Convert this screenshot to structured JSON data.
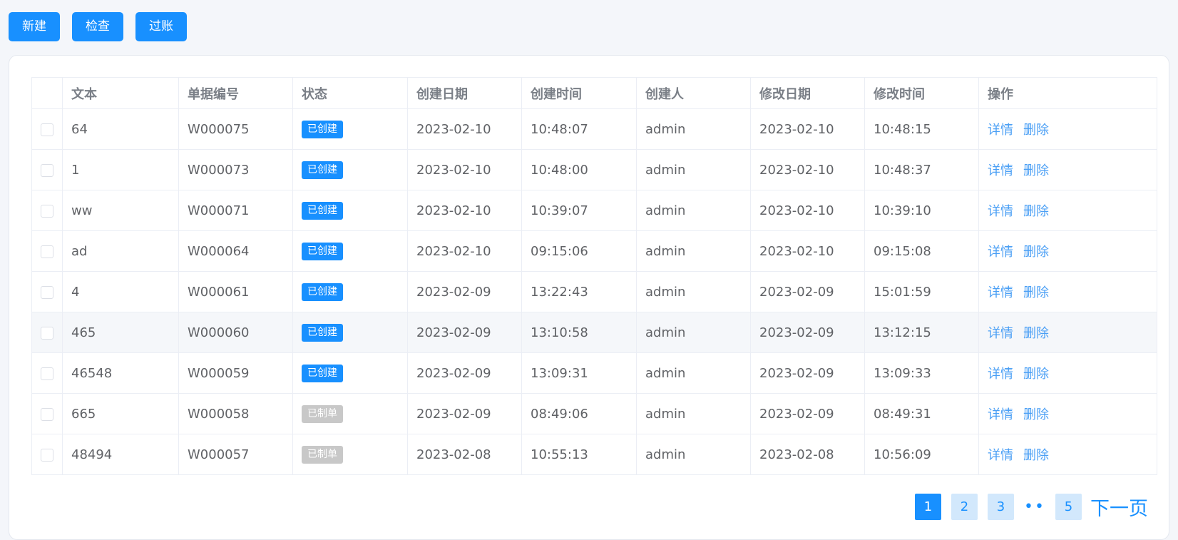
{
  "toolbar": {
    "new_label": "新建",
    "check_label": "检查",
    "post_label": "过账"
  },
  "table": {
    "headers": [
      "文本",
      "单据编号",
      "状态",
      "创建日期",
      "创建时间",
      "创建人",
      "修改日期",
      "修改时间",
      "操作"
    ],
    "actions": {
      "detail": "详情",
      "delete": "删除"
    },
    "rows": [
      {
        "text": "64",
        "code": "W000075",
        "status": "已创建",
        "cdate": "2023-02-10",
        "ctime": "10:48:07",
        "creator": "admin",
        "mdate": "2023-02-10",
        "mtime": "10:48:15"
      },
      {
        "text": "1",
        "code": "W000073",
        "status": "已创建",
        "cdate": "2023-02-10",
        "ctime": "10:48:00",
        "creator": "admin",
        "mdate": "2023-02-10",
        "mtime": "10:48:37"
      },
      {
        "text": "ww",
        "code": "W000071",
        "status": "已创建",
        "cdate": "2023-02-10",
        "ctime": "10:39:07",
        "creator": "admin",
        "mdate": "2023-02-10",
        "mtime": "10:39:10"
      },
      {
        "text": "ad",
        "code": "W000064",
        "status": "已创建",
        "cdate": "2023-02-10",
        "ctime": "09:15:06",
        "creator": "admin",
        "mdate": "2023-02-10",
        "mtime": "09:15:08"
      },
      {
        "text": "4",
        "code": "W000061",
        "status": "已创建",
        "cdate": "2023-02-09",
        "ctime": "13:22:43",
        "creator": "admin",
        "mdate": "2023-02-09",
        "mtime": "15:01:59"
      },
      {
        "text": "465",
        "code": "W000060",
        "status": "已创建",
        "cdate": "2023-02-09",
        "ctime": "13:10:58",
        "creator": "admin",
        "mdate": "2023-02-09",
        "mtime": "13:12:15"
      },
      {
        "text": "46548",
        "code": "W000059",
        "status": "已创建",
        "cdate": "2023-02-09",
        "ctime": "13:09:31",
        "creator": "admin",
        "mdate": "2023-02-09",
        "mtime": "13:09:33"
      },
      {
        "text": "665",
        "code": "W000058",
        "status": "已制单",
        "cdate": "2023-02-09",
        "ctime": "08:49:06",
        "creator": "admin",
        "mdate": "2023-02-09",
        "mtime": "08:49:31"
      },
      {
        "text": "48494",
        "code": "W000057",
        "status": "已制单",
        "cdate": "2023-02-08",
        "ctime": "10:55:13",
        "creator": "admin",
        "mdate": "2023-02-08",
        "mtime": "10:56:09"
      }
    ]
  },
  "status_colors": {
    "已创建": "#1890ff",
    "已制单": "#c8c8c8"
  },
  "pagination": {
    "pages": [
      "1",
      "2",
      "3"
    ],
    "ellipsis": "••",
    "last": "5",
    "current": "1",
    "next_label": "下一页"
  }
}
